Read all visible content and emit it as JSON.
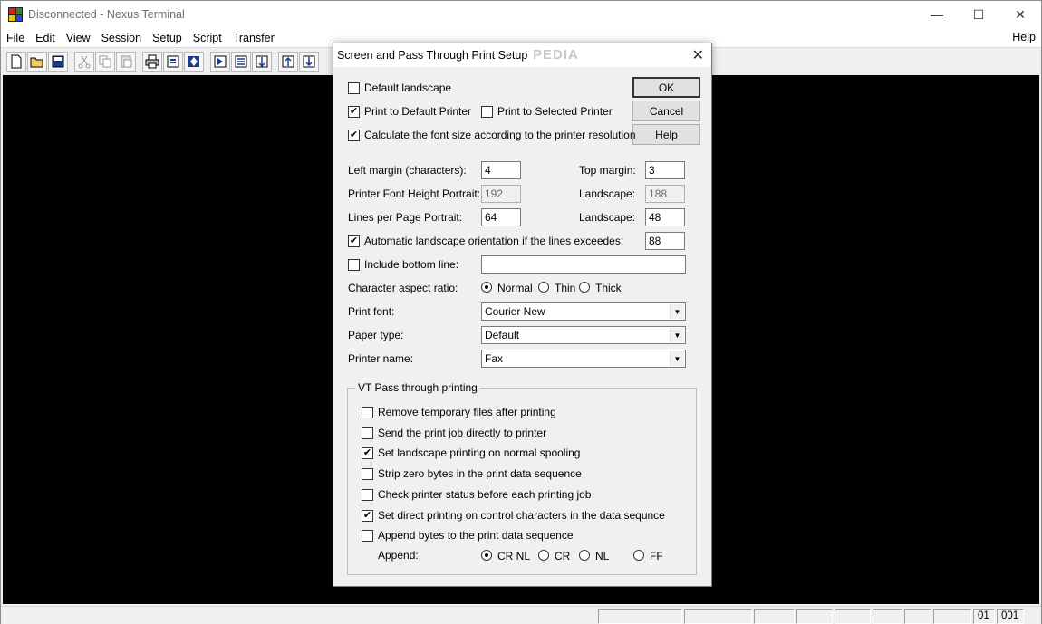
{
  "window": {
    "title": "Disconnected - Nexus Terminal",
    "minimize": "—",
    "maximize": "☐",
    "close": "✕"
  },
  "menu": [
    "File",
    "Edit",
    "View",
    "Session",
    "Setup",
    "Script",
    "Transfer"
  ],
  "menu_help": "Help",
  "toolbar": [
    "new-file",
    "open-folder",
    "save",
    "cut",
    "copy",
    "paste",
    "print",
    "session-setup",
    "connect",
    "script-run",
    "screen-setup",
    "transfer",
    "upload",
    "download"
  ],
  "status_bar": {
    "cells": [
      "",
      "",
      "",
      "",
      "",
      "",
      "",
      "",
      "01",
      "001"
    ]
  },
  "dialog": {
    "title": "Screen and Pass Through Print Setup",
    "close": "✕",
    "watermark": "PEDIA",
    "buttons": {
      "ok": "OK",
      "cancel": "Cancel",
      "help": "Help"
    },
    "default_landscape": {
      "label": "Default landscape",
      "checked": false
    },
    "print_default": {
      "label": "Print to Default Printer",
      "checked": true
    },
    "print_selected": {
      "label": "Print to Selected Printer",
      "checked": false
    },
    "calc_font": {
      "label": "Calculate the font size according to the printer resolution",
      "checked": true
    },
    "left_margin": {
      "label": "Left margin (characters):",
      "value": "4"
    },
    "top_margin": {
      "label": "Top margin:",
      "value": "3"
    },
    "font_height": {
      "label": "Printer Font Height Portrait:",
      "value": "192"
    },
    "font_height_landscape": {
      "label": "Landscape:",
      "value": "188"
    },
    "lines_per_page": {
      "label": "Lines per Page Portrait:",
      "value": "64"
    },
    "lines_landscape": {
      "label": "Landscape:",
      "value": "48"
    },
    "auto_landscape": {
      "label": "Automatic landscape orientation if the lines exceedes:",
      "checked": true,
      "value": "88"
    },
    "bottom_line": {
      "label": "Include bottom line:",
      "checked": false,
      "value": ""
    },
    "aspect": {
      "label": "Character aspect ratio:",
      "options": [
        "Normal",
        "Thin",
        "Thick"
      ],
      "selected": "Normal"
    },
    "print_font": {
      "label": "Print font:",
      "value": "Courier New"
    },
    "paper_type": {
      "label": "Paper type:",
      "value": "Default"
    },
    "printer_name": {
      "label": "Printer name:",
      "value": "Fax"
    },
    "vt_group": {
      "title": "VT Pass through printing",
      "options": [
        {
          "label": "Remove temporary files after printing",
          "checked": false
        },
        {
          "label": "Send the print job directly to printer",
          "checked": false
        },
        {
          "label": "Set landscape printing on normal spooling",
          "checked": true
        },
        {
          "label": "Strip zero bytes in the print data sequence",
          "checked": false
        },
        {
          "label": "Check printer status before each printing job",
          "checked": false
        },
        {
          "label": "Set direct printing on control characters in the data sequnce",
          "checked": true
        },
        {
          "label": "Append bytes to the print data sequence",
          "checked": false
        }
      ],
      "append_label": "Append:",
      "append_options": [
        "CR NL",
        "CR",
        "NL",
        "FF"
      ],
      "append_selected": "CR NL"
    }
  },
  "colors": {
    "terminal_bg": "#000000",
    "dialog_border": "#5a7fb5"
  }
}
